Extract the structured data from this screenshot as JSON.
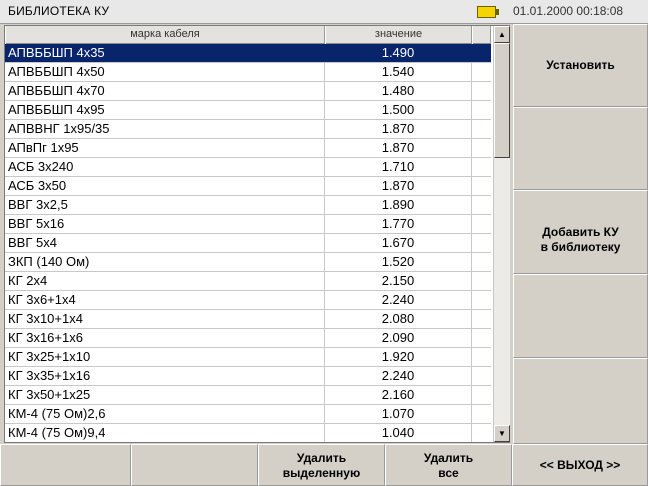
{
  "window": {
    "title": "БИБЛИОТЕКА КУ",
    "clock": "01.01.2000 00:18:08",
    "battery_icon": "battery-icon",
    "battery_color": "#f6d400"
  },
  "table": {
    "columns": [
      "марка кабеля",
      "значение"
    ],
    "selected_index": 0,
    "selected_color": "#08246b",
    "rows": [
      {
        "name": "АПВББШП 4х35",
        "value": "1.490"
      },
      {
        "name": "АПВББШП 4х50",
        "value": "1.540"
      },
      {
        "name": "АПВББШП 4х70",
        "value": "1.480"
      },
      {
        "name": "АПВББШП 4х95",
        "value": "1.500"
      },
      {
        "name": "АПВВНГ 1х95/35",
        "value": "1.870"
      },
      {
        "name": "АПвПг 1х95",
        "value": "1.870"
      },
      {
        "name": "АСБ 3х240",
        "value": "1.710"
      },
      {
        "name": "АСБ 3х50",
        "value": "1.870"
      },
      {
        "name": "ВВГ 3х2,5",
        "value": "1.890"
      },
      {
        "name": "ВВГ 5х16",
        "value": "1.770"
      },
      {
        "name": "ВВГ 5х4",
        "value": "1.670"
      },
      {
        "name": "ЗКП (140 Ом)",
        "value": "1.520"
      },
      {
        "name": "КГ 2х4",
        "value": "2.150"
      },
      {
        "name": "КГ 3х6+1х4",
        "value": "2.240"
      },
      {
        "name": "КГ 3х10+1х4",
        "value": "2.080"
      },
      {
        "name": "КГ 3х16+1х6",
        "value": "2.090"
      },
      {
        "name": "КГ 3х25+1х10",
        "value": "1.920"
      },
      {
        "name": "КГ 3х35+1х16",
        "value": "2.240"
      },
      {
        "name": "КГ 3х50+1х25",
        "value": "2.160"
      },
      {
        "name": "КМ-4 (75 Ом)2,6",
        "value": "1.070"
      },
      {
        "name": "КМ-4 (75 Ом)9,4",
        "value": "1.040"
      }
    ]
  },
  "scrollbar": {
    "up_icon": "arrow-up-icon",
    "down_icon": "arrow-down-icon",
    "up_glyph": "▲",
    "down_glyph": "▼"
  },
  "side_buttons": {
    "set": "Установить",
    "add_line1": "Добавить КУ",
    "add_line2": "в библиотеку"
  },
  "bottom_buttons": {
    "delete_selected_line1": "Удалить",
    "delete_selected_line2": "выделенную",
    "delete_all_line1": "Удалить",
    "delete_all_line2": "все",
    "exit": "<< ВЫХОД >>"
  }
}
